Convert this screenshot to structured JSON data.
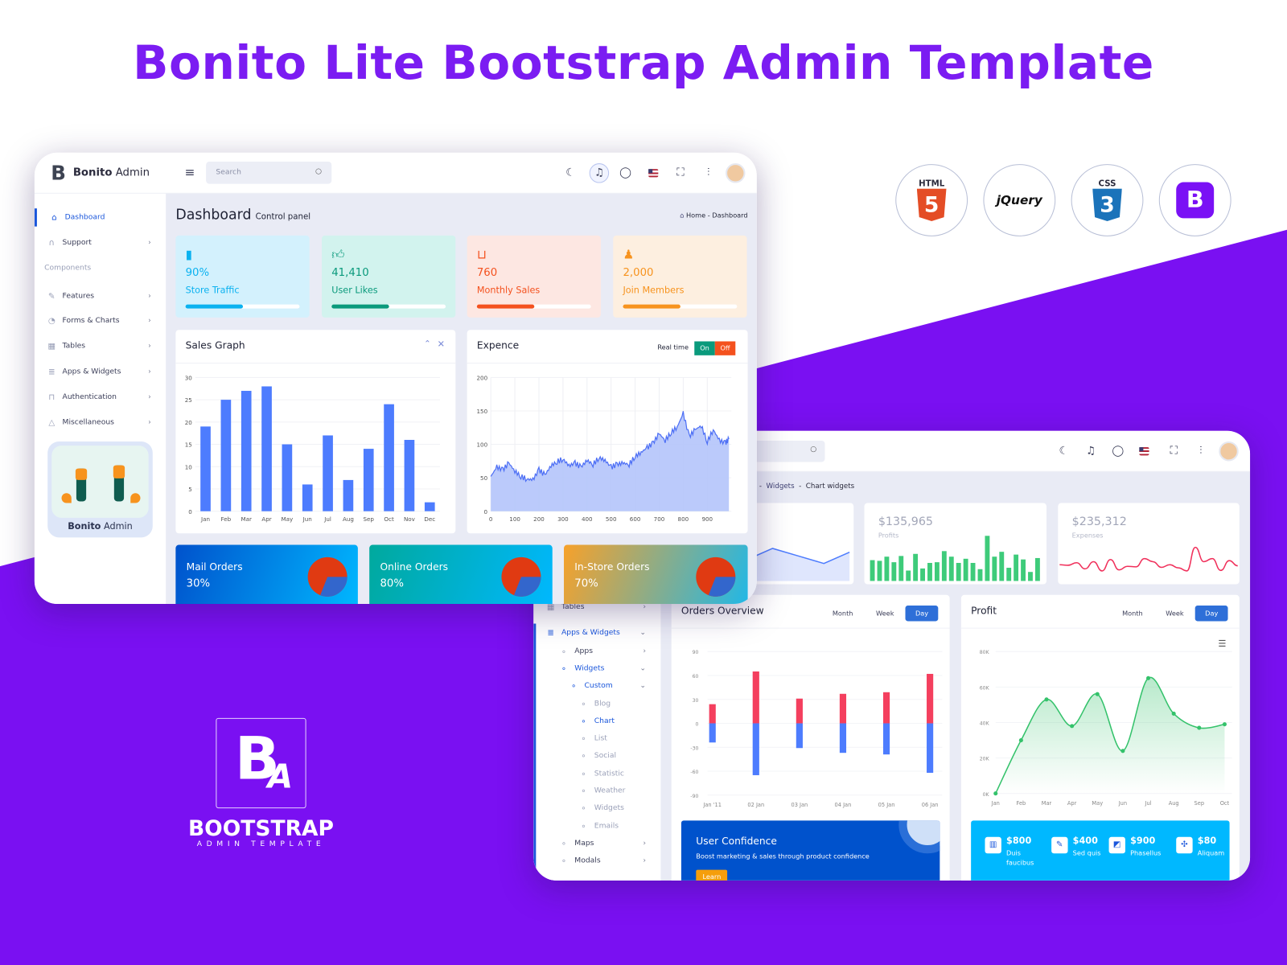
{
  "page": {
    "title": "Bonito Lite Bootstrap Admin Template",
    "colors": {
      "brand_purple": "#7b1cf2",
      "background_purple": "#7a10f2",
      "primary_blue": "#4d7cfe",
      "active_blue": "#1a56db"
    }
  },
  "tech_badges": [
    {
      "name": "html5",
      "label": "HTML",
      "glyph": "5",
      "color": "#e44d26"
    },
    {
      "name": "jquery",
      "label": "jQuery",
      "color": "#111111"
    },
    {
      "name": "css3",
      "label": "CSS",
      "glyph": "3",
      "color": "#1b73ba"
    },
    {
      "name": "bootstrap",
      "label": "B",
      "color": "#7a11f5"
    }
  ],
  "brand_logo": {
    "mark_b": "B",
    "mark_a": "A",
    "word": "BOOTSTRAP",
    "sub": "ADMIN TEMPLATE"
  },
  "window1": {
    "logo": {
      "mark": "B",
      "bold": "Bonito",
      "light": "Admin"
    },
    "search_placeholder": "Search",
    "header_icons": [
      "moon-icon",
      "bell-icon",
      "chat-icon",
      "flag-us-icon",
      "fullscreen-icon",
      "sliders-icon",
      "avatar"
    ],
    "sidebar": {
      "items": [
        {
          "label": "Dashboard",
          "icon": "home-icon",
          "active": true
        },
        {
          "label": "Support",
          "icon": "headphones-icon",
          "chevron": true
        },
        {
          "label": "Components",
          "section": true
        },
        {
          "label": "Features",
          "icon": "edit-icon",
          "chevron": true
        },
        {
          "label": "Forms & Charts",
          "icon": "pie-chart-icon",
          "chevron": true
        },
        {
          "label": "Tables",
          "icon": "grid-icon",
          "chevron": true
        },
        {
          "label": "Apps & Widgets",
          "icon": "database-icon",
          "chevron": true
        },
        {
          "label": "Authentication",
          "icon": "lock-icon",
          "chevron": true
        },
        {
          "label": "Miscellaneous",
          "icon": "alert-triangle-icon",
          "chevron": true
        }
      ],
      "promo": {
        "bold": "Bonito",
        "light": "Admin"
      }
    },
    "page_title": "Dashboard",
    "page_subtitle": "Control panel",
    "breadcrumb": {
      "home": "Home",
      "sep": "-",
      "current": "Dashboard"
    },
    "stats": [
      {
        "value": "90%",
        "label": "Store Traffic",
        "icon": "bar-chart-icon",
        "bg": "#d3f1fd",
        "color": "#0bb2f0",
        "progress": 50
      },
      {
        "value": "41,410",
        "label": "User Likes",
        "icon": "thumbs-up-icon",
        "bg": "#d2f3ee",
        "color": "#0a9a7c",
        "progress": 50
      },
      {
        "value": "760",
        "label": "Monthly Sales",
        "icon": "shopping-bag-icon",
        "bg": "#fde7e2",
        "color": "#f4511e",
        "progress": 50
      },
      {
        "value": "2,000",
        "label": "Join Members",
        "icon": "users-icon",
        "bg": "#fdefe0",
        "color": "#f7931e",
        "progress": 50
      }
    ],
    "sales_graph": {
      "title": "Sales Graph"
    },
    "expence": {
      "title": "Expence",
      "realtime_label": "Real time",
      "on": "On",
      "off": "Off"
    },
    "orders": [
      {
        "title": "Mail Orders",
        "value": "30%"
      },
      {
        "title": "Online Orders",
        "value": "80%"
      },
      {
        "title": "In-Store Orders",
        "value": "70%"
      }
    ]
  },
  "window2": {
    "breadcrumb": {
      "sep": "-",
      "parent": "Widgets",
      "current": "Chart widgets"
    },
    "widgets": [
      {
        "value": "$135,965",
        "label": "Profits"
      },
      {
        "value": "$235,312",
        "label": "Expenses"
      }
    ],
    "sidebar": {
      "items": [
        {
          "label": "Tables",
          "level": 0,
          "chevron": ">"
        },
        {
          "label": "Apps & Widgets",
          "level": 0,
          "chevron": "v",
          "active": true
        },
        {
          "label": "Apps",
          "level": 1,
          "chevron": ">"
        },
        {
          "label": "Widgets",
          "level": 1,
          "chevron": "v",
          "active": true
        },
        {
          "label": "Custom",
          "level": 2,
          "chevron": "v",
          "active": true
        },
        {
          "label": "Blog",
          "level": 3
        },
        {
          "label": "Chart",
          "level": 3,
          "active": true
        },
        {
          "label": "List",
          "level": 3
        },
        {
          "label": "Social",
          "level": 3
        },
        {
          "label": "Statistic",
          "level": 3
        },
        {
          "label": "Weather",
          "level": 3
        },
        {
          "label": "Widgets",
          "level": 3
        },
        {
          "label": "Emails",
          "level": 3
        },
        {
          "label": "Maps",
          "level": 1,
          "chevron": ">"
        },
        {
          "label": "Modals",
          "level": 1,
          "chevron": ">"
        }
      ]
    },
    "orders_overview": {
      "title": "Orders Overview",
      "tabs": [
        "Month",
        "Week",
        "Day"
      ],
      "active_tab": "Day"
    },
    "profit": {
      "title": "Profit",
      "tabs": [
        "Month",
        "Week",
        "Day"
      ],
      "active_tab": "Day"
    },
    "banner": {
      "title": "User Confidence",
      "text": "Boost marketing & sales through product confidence",
      "button": "Learn"
    },
    "profit_stats": [
      {
        "value": "$800",
        "label": "Duis faucibus",
        "icon": "books-icon"
      },
      {
        "value": "$400",
        "label": "Sed quis",
        "icon": "pencil-icon"
      },
      {
        "value": "$900",
        "label": "Phasellus",
        "icon": "layers-icon"
      },
      {
        "value": "$80",
        "label": "Aliquam",
        "icon": "puzzle-icon"
      }
    ]
  },
  "chart_data": [
    {
      "id": "sales",
      "type": "bar",
      "categories": [
        "Jan",
        "Feb",
        "Mar",
        "Apr",
        "May",
        "Jun",
        "Jul",
        "Aug",
        "Sep",
        "Oct",
        "Nov",
        "Dec"
      ],
      "values": [
        19,
        25,
        27,
        28,
        15,
        6,
        17,
        7,
        14,
        24,
        16,
        2
      ],
      "ylim": [
        0,
        30
      ],
      "yticks": [
        0,
        5,
        10,
        15,
        20,
        25,
        30
      ],
      "color": "#4d7cfe",
      "grid": true
    },
    {
      "id": "expence",
      "type": "area",
      "x": [
        0,
        25,
        50,
        75,
        100,
        125,
        150,
        175,
        200,
        225,
        250,
        275,
        300,
        325,
        350,
        375,
        400,
        425,
        450,
        475,
        500,
        525,
        550,
        575,
        600,
        625,
        650,
        675,
        700,
        725,
        750,
        775,
        800,
        825,
        850,
        875,
        900,
        925,
        950,
        975,
        990
      ],
      "y": [
        52,
        66,
        62,
        72,
        60,
        52,
        48,
        47,
        62,
        54,
        68,
        74,
        78,
        68,
        72,
        66,
        76,
        70,
        80,
        76,
        66,
        70,
        72,
        70,
        82,
        88,
        95,
        102,
        116,
        106,
        118,
        126,
        146,
        112,
        122,
        128,
        104,
        122,
        106,
        102,
        108
      ],
      "xlim": [
        0,
        1000
      ],
      "ylim": [
        0,
        200
      ],
      "xticks": [
        0,
        100,
        200,
        300,
        400,
        500,
        600,
        700,
        800,
        900
      ],
      "yticks": [
        0,
        50,
        100,
        150,
        200
      ],
      "color": "#4d6ff5",
      "fill": "#b4c4fb",
      "grid": true
    },
    {
      "id": "orders_overview",
      "type": "bar",
      "stacked": true,
      "categories": [
        "Jan '11",
        "02 Jan",
        "03 Jan",
        "04 Jan",
        "05 Jan",
        "06 Jan"
      ],
      "series": [
        {
          "values": [
            24,
            65,
            31,
            37,
            39,
            62
          ],
          "color": "#f43f5e"
        },
        {
          "values": [
            -24,
            -65,
            -31,
            -37,
            -39,
            -62
          ],
          "color": "#4d7cfe"
        }
      ],
      "ylim": [
        -90,
        90
      ],
      "yticks": [
        90,
        60,
        30,
        0,
        -30,
        -60,
        -90
      ]
    },
    {
      "id": "profit",
      "type": "area",
      "smooth": true,
      "categories": [
        "Jan",
        "Feb",
        "Mar",
        "Apr",
        "May",
        "Jun",
        "Jul",
        "Aug",
        "Sep",
        "Oct"
      ],
      "values": [
        0,
        30,
        53,
        38,
        56,
        24,
        65,
        45,
        37,
        39
      ],
      "ylim": [
        0,
        80
      ],
      "yticks": [
        "0K",
        "20K",
        "40K",
        "60K",
        "80K"
      ],
      "color": "#34c26b"
    },
    {
      "id": "widget_line",
      "type": "area",
      "values": [
        40,
        30,
        25,
        28,
        26,
        60,
        35,
        40,
        25,
        40,
        30,
        20,
        35
      ],
      "color": "#4d7cfe"
    },
    {
      "id": "widget_profits",
      "type": "bar",
      "values": [
        30,
        29,
        35,
        27,
        36,
        15,
        39,
        18,
        26,
        27,
        43,
        35,
        26,
        32,
        26,
        17,
        65,
        35,
        42,
        19,
        38,
        31,
        13,
        33
      ],
      "color": "#3ecb7a"
    },
    {
      "id": "widget_expenses",
      "type": "line",
      "values": [
        30,
        29,
        34,
        22,
        36,
        18,
        40,
        20,
        27,
        26,
        42,
        36,
        25,
        30,
        24,
        18,
        64,
        36,
        42,
        19,
        38,
        28
      ],
      "color": "#f0305b"
    }
  ]
}
